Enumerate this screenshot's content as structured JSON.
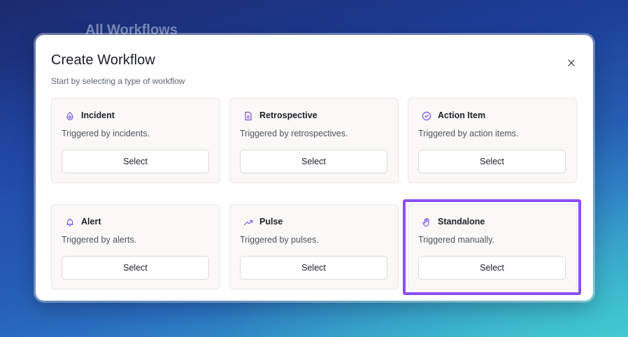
{
  "background": {
    "page_title": "All Workflows"
  },
  "modal": {
    "title": "Create Workflow",
    "subtitle": "Start by selecting a type of workflow",
    "close_icon": "close-icon"
  },
  "colors": {
    "accent": "#8d4ff1",
    "icon": "#7c4fe0",
    "card_bg": "#faf9f8"
  },
  "cards": [
    {
      "title": "Incident",
      "description": "Triggered by incidents.",
      "button": "Select",
      "icon": "incident-icon"
    },
    {
      "title": "Retrospective",
      "description": "Triggered by retrospectives.",
      "button": "Select",
      "icon": "document-icon"
    },
    {
      "title": "Action Item",
      "description": "Triggered by action items.",
      "button": "Select",
      "icon": "check-circle-icon"
    },
    {
      "title": "Alert",
      "description": "Triggered by alerts.",
      "button": "Select",
      "icon": "bell-icon"
    },
    {
      "title": "Pulse",
      "description": "Triggered by pulses.",
      "button": "Select",
      "icon": "trending-up-icon"
    },
    {
      "title": "Standalone",
      "description": "Triggered manually.",
      "button": "Select",
      "icon": "hand-icon",
      "highlighted": true
    }
  ]
}
